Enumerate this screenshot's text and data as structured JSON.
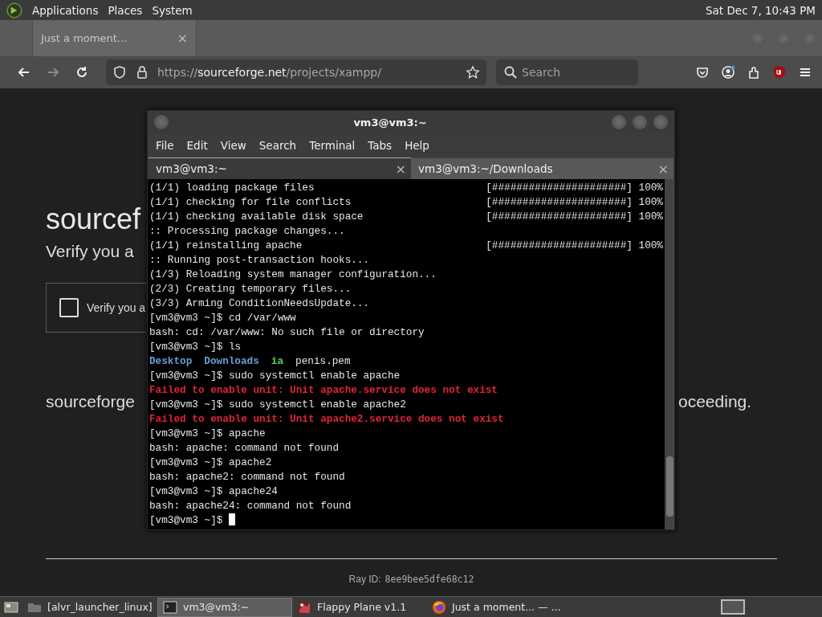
{
  "top_panel": {
    "menus": [
      "Applications",
      "Places",
      "System"
    ],
    "clock": "Sat Dec 7, 10:43 PM"
  },
  "browser": {
    "tabs": [
      {
        "title": "Just a moment...",
        "close": "×",
        "selected": true
      }
    ],
    "nav_buttons": [
      {
        "kind": "back",
        "disabled": false
      },
      {
        "kind": "forward",
        "disabled": true
      },
      {
        "kind": "reload",
        "disabled": false
      }
    ],
    "url": {
      "scheme": "https://",
      "host": "sourceforge.net",
      "path": "/projects/xampp/"
    },
    "search": {
      "placeholder": "Search"
    },
    "toolbar_icons": [
      {
        "kind": "pocket"
      },
      {
        "kind": "account"
      },
      {
        "kind": "extensions"
      },
      {
        "kind": "ublock"
      },
      {
        "kind": "menu"
      }
    ]
  },
  "page": {
    "heading": "sourcef",
    "subheading": "Verify you a",
    "checkbox": {
      "label": "Verify you a",
      "checked": false
    },
    "notice_left": "sourceforge",
    "notice_right": "oceeding.",
    "ray_label": "Ray ID:",
    "ray_id": "8ee9bee5dfe68c12"
  },
  "terminal": {
    "title": "vm3@vm3:~",
    "menus": [
      "File",
      "Edit",
      "View",
      "Search",
      "Terminal",
      "Tabs",
      "Help"
    ],
    "tabs": [
      {
        "title": "vm3@vm3:~",
        "close": "×",
        "selected": true
      },
      {
        "title": "vm3@vm3:~/Downloads",
        "close": "×",
        "selected": false
      }
    ],
    "lines": [
      {
        "kind": "progress",
        "text": "(1/1) loading package files",
        "bar": "[######################] 100%"
      },
      {
        "kind": "progress",
        "text": "(1/1) checking for file conflicts",
        "bar": "[######################] 100%"
      },
      {
        "kind": "progress",
        "text": "(1/1) checking available disk space",
        "bar": "[######################] 100%"
      },
      {
        "kind": "plain",
        "text": ":: Processing package changes..."
      },
      {
        "kind": "progress",
        "text": "(1/1) reinstalling apache",
        "bar": "[######################] 100%"
      },
      {
        "kind": "plain",
        "text": ":: Running post-transaction hooks..."
      },
      {
        "kind": "plain",
        "text": "(1/3) Reloading system manager configuration..."
      },
      {
        "kind": "plain",
        "text": "(2/3) Creating temporary files..."
      },
      {
        "kind": "plain",
        "text": "(3/3) Arming ConditionNeedsUpdate..."
      },
      {
        "kind": "plain",
        "text": "[vm3@vm3 ~]$ cd /var/www"
      },
      {
        "kind": "plain",
        "text": "bash: cd: /var/www: No such file or directory"
      },
      {
        "kind": "plain",
        "text": "[vm3@vm3 ~]$ ls"
      },
      {
        "kind": "listing",
        "items": [
          {
            "text": "Desktop",
            "kind": "dir"
          },
          {
            "text": "Downloads",
            "kind": "dir"
          },
          {
            "text": "ia",
            "kind": "exec"
          },
          {
            "text": "penis.pem",
            "kind": "file"
          }
        ]
      },
      {
        "kind": "plain",
        "text": "[vm3@vm3 ~]$ sudo systemctl enable apache"
      },
      {
        "kind": "error",
        "text": "Failed to enable unit: Unit apache.service does not exist"
      },
      {
        "kind": "plain",
        "text": "[vm3@vm3 ~]$ sudo systemctl enable apache2"
      },
      {
        "kind": "error",
        "text": "Failed to enable unit: Unit apache2.service does not exist"
      },
      {
        "kind": "plain",
        "text": "[vm3@vm3 ~]$ apache"
      },
      {
        "kind": "plain",
        "text": "bash: apache: command not found"
      },
      {
        "kind": "plain",
        "text": "[vm3@vm3 ~]$ apache2"
      },
      {
        "kind": "plain",
        "text": "bash: apache2: command not found"
      },
      {
        "kind": "plain",
        "text": "[vm3@vm3 ~]$ apache24"
      },
      {
        "kind": "plain",
        "text": "bash: apache24: command not found"
      },
      {
        "kind": "prompt",
        "text": "[vm3@vm3 ~]$"
      }
    ]
  },
  "taskbar": {
    "items": [
      {
        "kind": "folder",
        "title": "[alvr_launcher_linux]",
        "selected": false
      },
      {
        "kind": "terminal",
        "title": "vm3@vm3:~",
        "selected": true
      },
      {
        "kind": "game",
        "title": "Flappy Plane v1.1",
        "selected": false
      },
      {
        "kind": "browser",
        "title": "Just a moment... — ...",
        "selected": false
      }
    ]
  }
}
